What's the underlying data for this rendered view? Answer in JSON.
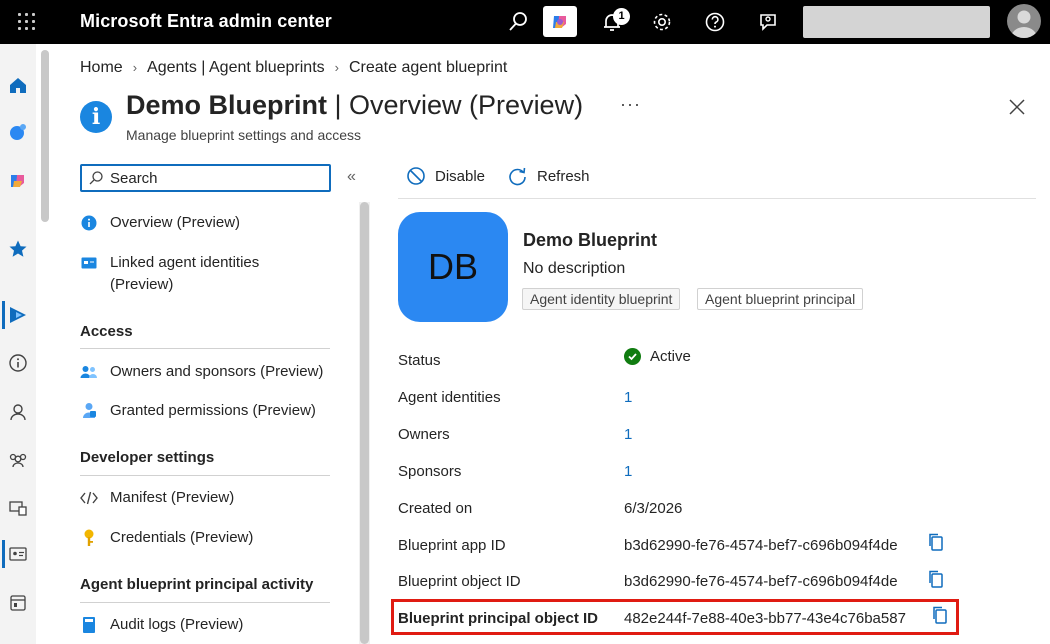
{
  "topbar": {
    "app_title": "Microsoft Entra admin center",
    "notification_count": "1"
  },
  "breadcrumb": [
    "Home",
    "Agents | Agent blueprints",
    "Create agent blueprint"
  ],
  "header": {
    "title_bold": "Demo Blueprint",
    "title_rest": " | Overview (Preview)",
    "subtitle": "Manage blueprint settings and access",
    "more": "···"
  },
  "nav": {
    "search_placeholder": "Search",
    "collapse": "«",
    "items": {
      "overview": "Overview (Preview)",
      "linked_line1": "Linked agent identities",
      "linked_line2": "(Preview)",
      "owners": "Owners and sponsors (Preview)",
      "granted": "Granted permissions (Preview)",
      "manifest": "Manifest (Preview)",
      "credentials": "Credentials (Preview)",
      "audit": "Audit logs (Preview)"
    },
    "sections": {
      "access": "Access",
      "developer": "Developer settings",
      "activity": "Agent blueprint principal activity"
    }
  },
  "commands": {
    "disable": "Disable",
    "refresh": "Refresh"
  },
  "entity": {
    "initials": "DB",
    "name": "Demo Blueprint",
    "description": "No description",
    "tags": [
      "Agent identity blueprint",
      "Agent blueprint principal"
    ]
  },
  "properties": {
    "status_label": "Status",
    "status_value": "Active",
    "agent_identities_label": "Agent identities",
    "agent_identities_value": "1",
    "owners_label": "Owners",
    "owners_value": "1",
    "sponsors_label": "Sponsors",
    "sponsors_value": "1",
    "created_label": "Created on",
    "created_value": "6/3/2026",
    "app_id_label": "Blueprint app ID",
    "app_id_value": "b3d62990-fe76-4574-bef7-c696b094f4de",
    "object_id_label": "Blueprint object ID",
    "object_id_value": "b3d62990-fe76-4574-bef7-c696b094f4de",
    "principal_id_label": "Blueprint principal object ID",
    "principal_id_value": "482e244f-7e88-40e3-bb77-43e4c76ba587"
  },
  "colors": {
    "accent": "#0f6cbd",
    "tile": "#2b88f2",
    "active": "#107c10",
    "highlight": "#e01b12"
  }
}
